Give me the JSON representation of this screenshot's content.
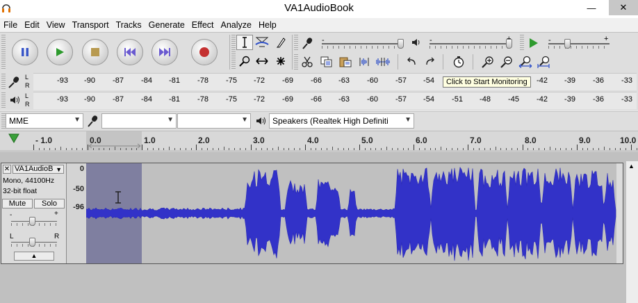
{
  "window": {
    "title": "VA1AudioBook",
    "minimize_glyph": "—",
    "close_glyph": "✕"
  },
  "menu": [
    "File",
    "Edit",
    "View",
    "Transport",
    "Tracks",
    "Generate",
    "Effect",
    "Analyze",
    "Help"
  ],
  "icons": [
    "pause-icon",
    "play-icon",
    "stop-icon",
    "skip-start-icon",
    "skip-end-icon",
    "record-icon",
    "selection-tool-icon",
    "envelope-tool-icon",
    "draw-tool-icon",
    "zoom-tool-icon",
    "timeshift-tool-icon",
    "multi-tool-icon",
    "microphone-icon",
    "speaker-icon",
    "cut-icon",
    "copy-icon",
    "paste-icon",
    "trim-icon",
    "silence-icon",
    "undo-icon",
    "redo-icon",
    "sync-lock-icon",
    "zoom-in-icon",
    "zoom-out-icon",
    "fit-selection-icon",
    "fit-project-icon"
  ],
  "meters": {
    "lr": [
      "L",
      "R"
    ],
    "record_ticks": [
      "-93",
      "-90",
      "-87",
      "-84",
      "-81",
      "-78",
      "-75",
      "-72",
      "-69",
      "-66",
      "-63",
      "-60",
      "-57",
      "-54",
      "-42",
      "-39",
      "-36",
      "-33"
    ],
    "playback_ticks": [
      "-93",
      "-90",
      "-87",
      "-84",
      "-81",
      "-78",
      "-75",
      "-72",
      "-69",
      "-66",
      "-63",
      "-60",
      "-57",
      "-54",
      "-51",
      "-48",
      "-45",
      "-42",
      "-39",
      "-36",
      "-33"
    ],
    "tooltip": "Click to Start Monitoring"
  },
  "sliders": {
    "playback_minus": "-",
    "playback_plus": "+",
    "speed_minus": "-",
    "speed_plus": "+"
  },
  "devices": {
    "host": "MME",
    "recording_device": "",
    "recording_channels": "",
    "playback_device": "Speakers (Realtek High Definiti"
  },
  "timeline": {
    "labels": [
      "- 1.0",
      "0.0",
      "1.0",
      "2.0",
      "3.0",
      "4.0",
      "5.0",
      "6.0",
      "7.0",
      "8.0",
      "9.0",
      "10.0"
    ],
    "values": [
      -1,
      0,
      1,
      2,
      3,
      4,
      5,
      6,
      7,
      8,
      9,
      10
    ],
    "selection_start_s": 0.0,
    "selection_end_s": 1.0
  },
  "track": {
    "name": "VA1AudioB",
    "info_line1": "Mono, 44100Hz",
    "info_line2": "32-bit float",
    "mute_label": "Mute",
    "solo_label": "Solo",
    "gain_minus": "-",
    "gain_plus": "+",
    "pan_left": "L",
    "pan_right": "R",
    "vruler": [
      "0",
      "-50",
      "-96"
    ],
    "colors": {
      "wave": "#3232c8",
      "selection": "#7f7fa0"
    }
  }
}
